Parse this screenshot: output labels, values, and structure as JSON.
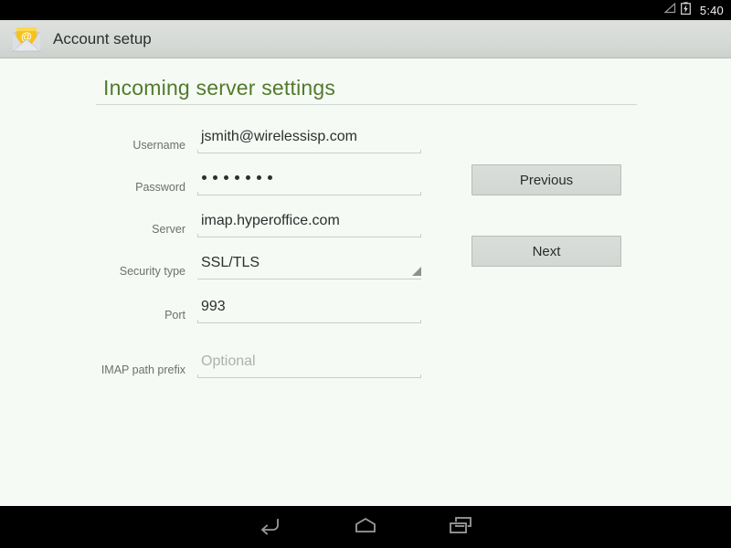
{
  "status_bar": {
    "time": "5:40",
    "icons": [
      "signal-triangle-icon",
      "battery-charging-icon"
    ]
  },
  "action_bar": {
    "title": "Account setup",
    "app_icon": "email-envelope-at-icon"
  },
  "content": {
    "section_title": "Incoming server settings",
    "title_color": "#537a2b",
    "background": "#f5faf5",
    "fields": [
      {
        "id": "username",
        "label": "Username",
        "value": "jsmith@wirelessisp.com",
        "placeholder": "",
        "type": "text"
      },
      {
        "id": "password",
        "label": "Password",
        "value": "•••••••",
        "dot_count": 7,
        "placeholder": "",
        "type": "password"
      },
      {
        "id": "server",
        "label": "Server",
        "value": "imap.hyperoffice.com",
        "placeholder": "",
        "type": "text"
      },
      {
        "id": "security-type",
        "label": "Security type",
        "value": "SSL/TLS",
        "placeholder": "",
        "type": "spinner",
        "caret_icon": "dropdown-triangle-icon"
      },
      {
        "id": "port",
        "label": "Port",
        "value": "993",
        "placeholder": "",
        "type": "number"
      },
      {
        "id": "imap-path-prefix",
        "label": "IMAP path prefix",
        "value": "",
        "placeholder": "Optional",
        "type": "text"
      }
    ],
    "buttons": {
      "previous": "Previous",
      "next": "Next"
    }
  },
  "nav_bar": {
    "back": "back-icon",
    "home": "home-icon",
    "recents": "recents-icon"
  }
}
